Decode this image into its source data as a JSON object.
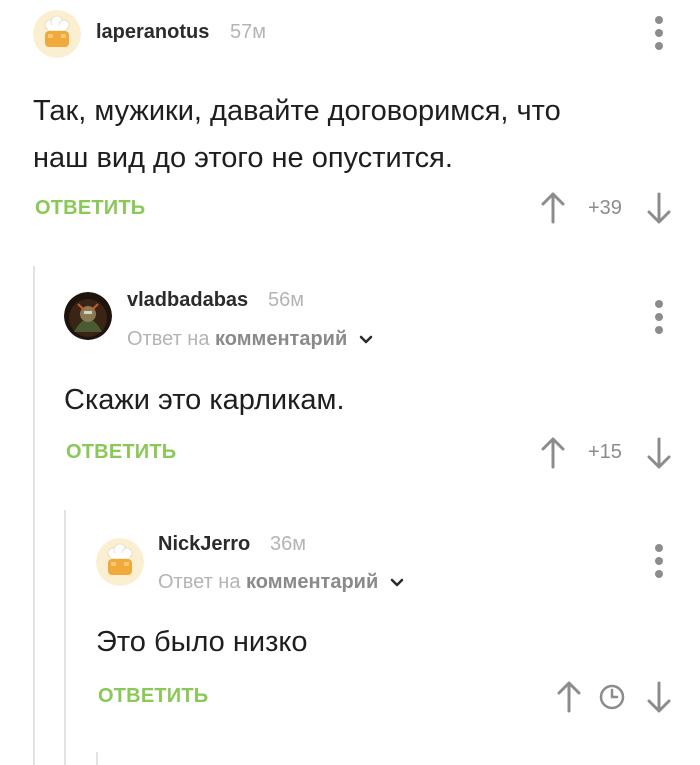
{
  "comments": [
    {
      "username": "laperanotus",
      "time": "57м",
      "text_lines": [
        "Так, мужики, давайте договоримся, что",
        "наш вид до этого не опустится."
      ],
      "reply_label": "ОТВЕТИТЬ",
      "score": "+39"
    },
    {
      "username": "vladbadabas",
      "time": "56м",
      "reply_to_prefix": "Ответ на",
      "reply_to_target": "комментарий",
      "text_lines": [
        "Скажи это карликам."
      ],
      "reply_label": "ОТВЕТИТЬ",
      "score": "+15"
    },
    {
      "username": "NickJerro",
      "time": "36м",
      "reply_to_prefix": "Ответ на",
      "reply_to_target": "комментарий",
      "text_lines": [
        "Это было низко"
      ],
      "reply_label": "ОТВЕТИТЬ",
      "score_icon": "clock-icon"
    }
  ],
  "colors": {
    "reply_green": "#8ac858",
    "muted_gray": "#b4b4b4",
    "icon_gray": "#8c8c8c",
    "thread_line": "#e2e2e2"
  }
}
